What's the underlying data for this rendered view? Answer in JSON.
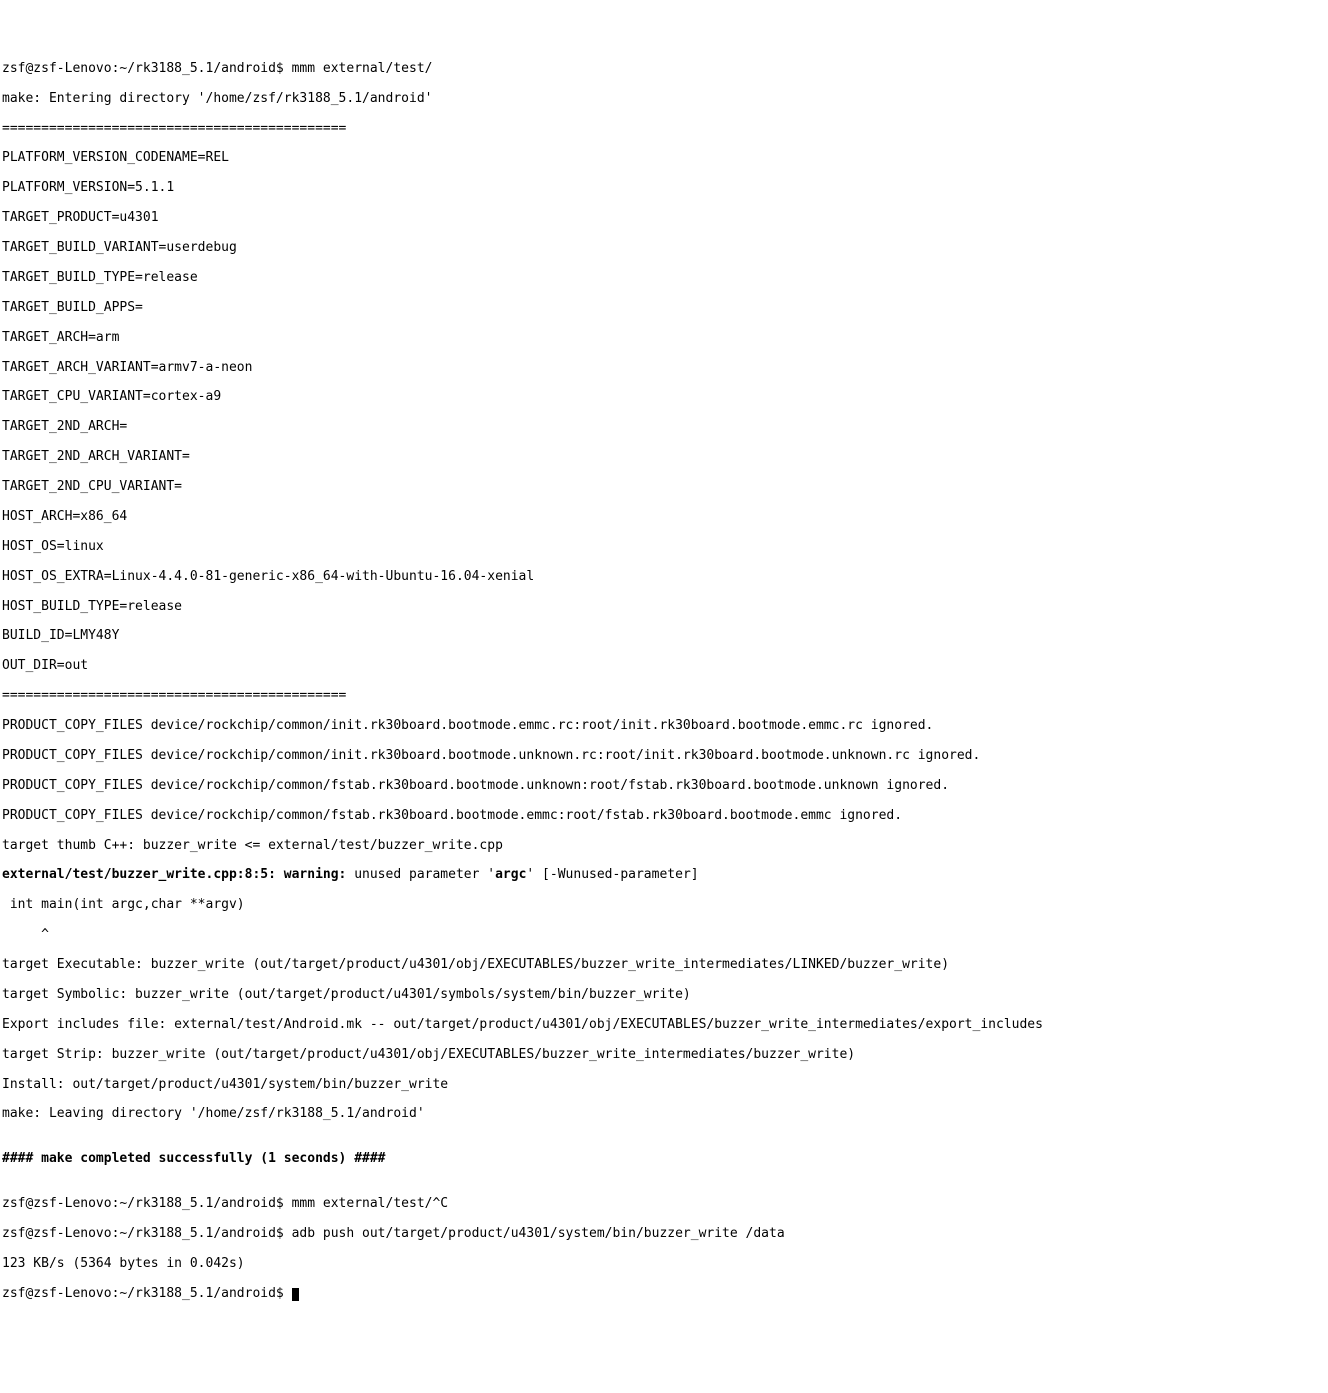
{
  "lines": [
    {
      "text": "zsf@zsf-Lenovo:~/rk3188_5.1/android$ mmm external/test/"
    },
    {
      "text": "make: Entering directory '/home/zsf/rk3188_5.1/android'"
    },
    {
      "text": "============================================"
    },
    {
      "text": "PLATFORM_VERSION_CODENAME=REL"
    },
    {
      "text": "PLATFORM_VERSION=5.1.1"
    },
    {
      "text": "TARGET_PRODUCT=u4301"
    },
    {
      "text": "TARGET_BUILD_VARIANT=userdebug"
    },
    {
      "text": "TARGET_BUILD_TYPE=release"
    },
    {
      "text": "TARGET_BUILD_APPS="
    },
    {
      "text": "TARGET_ARCH=arm"
    },
    {
      "text": "TARGET_ARCH_VARIANT=armv7-a-neon"
    },
    {
      "text": "TARGET_CPU_VARIANT=cortex-a9"
    },
    {
      "text": "TARGET_2ND_ARCH="
    },
    {
      "text": "TARGET_2ND_ARCH_VARIANT="
    },
    {
      "text": "TARGET_2ND_CPU_VARIANT="
    },
    {
      "text": "HOST_ARCH=x86_64"
    },
    {
      "text": "HOST_OS=linux"
    },
    {
      "text": "HOST_OS_EXTRA=Linux-4.4.0-81-generic-x86_64-with-Ubuntu-16.04-xenial"
    },
    {
      "text": "HOST_BUILD_TYPE=release"
    },
    {
      "text": "BUILD_ID=LMY48Y"
    },
    {
      "text": "OUT_DIR=out"
    },
    {
      "text": "============================================"
    },
    {
      "text": "PRODUCT_COPY_FILES device/rockchip/common/init.rk30board.bootmode.emmc.rc:root/init.rk30board.bootmode.emmc.rc ignored."
    },
    {
      "text": "PRODUCT_COPY_FILES device/rockchip/common/init.rk30board.bootmode.unknown.rc:root/init.rk30board.bootmode.unknown.rc ignored."
    },
    {
      "text": "PRODUCT_COPY_FILES device/rockchip/common/fstab.rk30board.bootmode.unknown:root/fstab.rk30board.bootmode.unknown ignored."
    },
    {
      "text": "PRODUCT_COPY_FILES device/rockchip/common/fstab.rk30board.bootmode.emmc:root/fstab.rk30board.bootmode.emmc ignored."
    },
    {
      "text": "target thumb C++: buzzer_write <= external/test/buzzer_write.cpp"
    },
    {
      "segments": [
        {
          "text": "external/test/buzzer_write.cpp:8:5: warning: ",
          "bold": true
        },
        {
          "text": "unused parameter '",
          "bold": false
        },
        {
          "text": "argc",
          "bold": true
        },
        {
          "text": "' [-Wunused-parameter]",
          "bold": false
        }
      ]
    },
    {
      "text": " int main(int argc,char **argv)"
    },
    {
      "text": "     ^"
    },
    {
      "text": "target Executable: buzzer_write (out/target/product/u4301/obj/EXECUTABLES/buzzer_write_intermediates/LINKED/buzzer_write)"
    },
    {
      "text": "target Symbolic: buzzer_write (out/target/product/u4301/symbols/system/bin/buzzer_write)"
    },
    {
      "text": "Export includes file: external/test/Android.mk -- out/target/product/u4301/obj/EXECUTABLES/buzzer_write_intermediates/export_includes"
    },
    {
      "text": "target Strip: buzzer_write (out/target/product/u4301/obj/EXECUTABLES/buzzer_write_intermediates/buzzer_write)"
    },
    {
      "text": "Install: out/target/product/u4301/system/bin/buzzer_write"
    },
    {
      "text": "make: Leaving directory '/home/zsf/rk3188_5.1/android'"
    },
    {
      "text": ""
    },
    {
      "segments": [
        {
          "text": "#### make completed successfully (1 seconds) ####",
          "bold": true
        }
      ]
    },
    {
      "text": ""
    },
    {
      "text": "zsf@zsf-Lenovo:~/rk3188_5.1/android$ mmm external/test/^C"
    },
    {
      "text": "zsf@zsf-Lenovo:~/rk3188_5.1/android$ adb push out/target/product/u4301/system/bin/buzzer_write /data"
    },
    {
      "text": "123 KB/s (5364 bytes in 0.042s)"
    },
    {
      "text": "zsf@zsf-Lenovo:~/rk3188_5.1/android$ ",
      "cursor": true
    }
  ]
}
